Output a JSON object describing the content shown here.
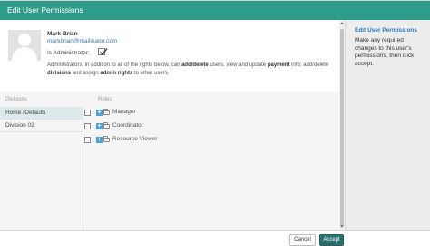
{
  "header": {
    "title": "Edit User Permissions"
  },
  "user": {
    "name": "Mark Brian",
    "email": "markbrian@mailinator.com",
    "admin_label": "Is Administrator:",
    "is_admin": true
  },
  "description": {
    "part1": "Administrators, in addition to all of the rights below, can ",
    "bold1": "add/delete",
    "part2": " users, view and update ",
    "bold2": "payment",
    "part3": " info, add/delete ",
    "bold3": "divisions",
    "part4": " and assign ",
    "bold4": "admin rights",
    "part5": " to other users."
  },
  "table": {
    "divisions_header": "Divisions",
    "roles_header": "Roles",
    "divisions": [
      {
        "label": "Home (Default)",
        "selected": true
      },
      {
        "label": "Division 02",
        "selected": false
      }
    ],
    "roles": [
      {
        "label": "Manager",
        "checked": false
      },
      {
        "label": "Coordinator",
        "checked": false
      },
      {
        "label": "Resource Viewer",
        "checked": false
      }
    ]
  },
  "sidebar": {
    "title": "Edit User Permissions",
    "text": "Make any required changes to this user's permissions, then click accept."
  },
  "footer": {
    "cancel_label": "Cancel",
    "accept_label": "Accept"
  },
  "colors": {
    "header": "#2f9b8b",
    "accept": "#2a6f6e",
    "link": "#2a7ab8",
    "expand": "#4aa3d4"
  }
}
